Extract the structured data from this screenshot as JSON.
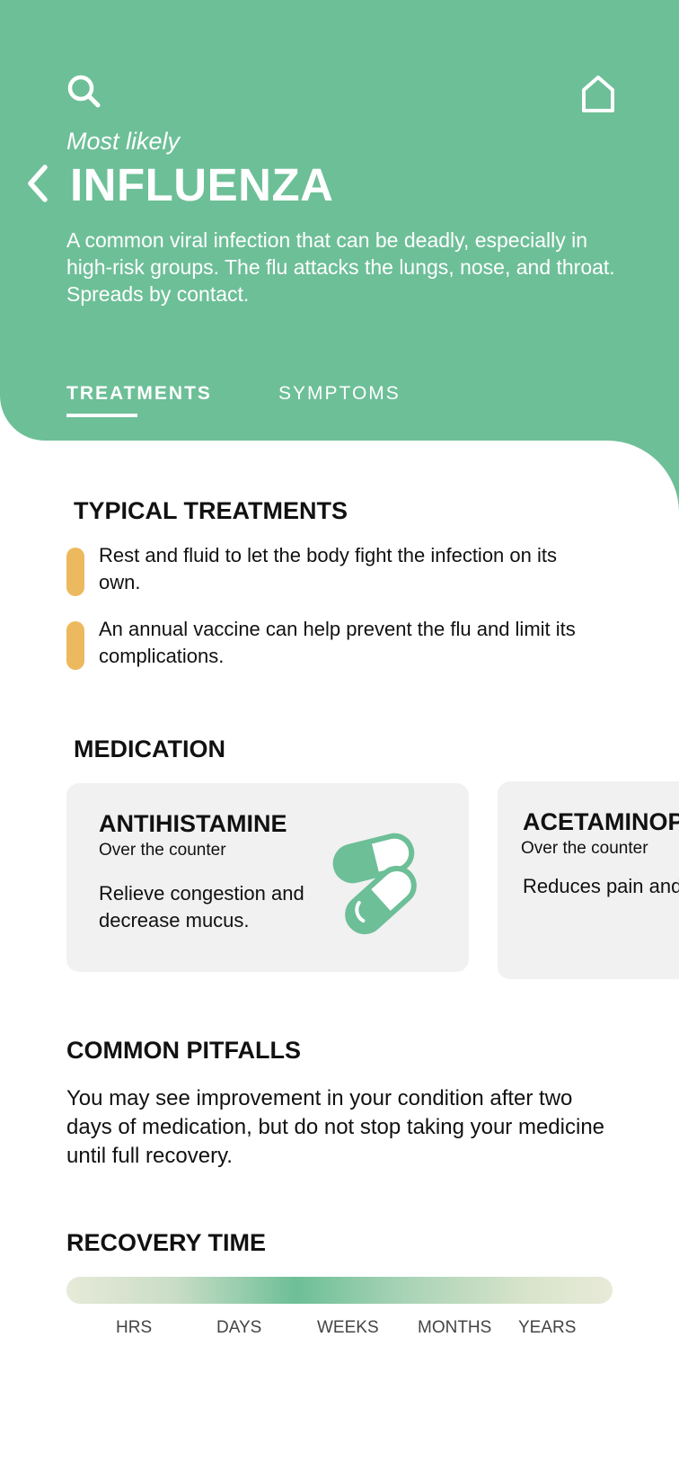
{
  "header": {
    "subtitle": "Most likely",
    "title": "INFLUENZA",
    "description": "A common viral infection that can be deadly, especially in high-risk groups. The flu attacks the lungs, nose, and throat. Spreads by contact.",
    "icons": {
      "search": "search-icon",
      "home": "home-icon",
      "back": "chevron-left-icon"
    }
  },
  "tabs": [
    {
      "label": "TREATMENTS",
      "active": true
    },
    {
      "label": "SYMPTOMS",
      "active": false
    }
  ],
  "typical_treatments": {
    "title": "TYPICAL TREATMENTS",
    "items": [
      "Rest and fluid to let the body fight the infection on its own.",
      "An annual vaccine can help prevent the flu and limit its complications."
    ]
  },
  "medication": {
    "title": "MEDICATION",
    "cards": [
      {
        "name": "ANTIHISTAMINE",
        "type": "Over the counter",
        "description": "Relieve congestion and decrease mucus.",
        "icon": "pills-icon"
      },
      {
        "name": "ACETAMINOPHEN",
        "type": "Over the counter",
        "description": "Reduces pain and fever."
      }
    ]
  },
  "common_pitfalls": {
    "title": "COMMON PITFALLS",
    "text": "You may see improvement in your condition after two days of medication, but do not stop taking your medicine until full recovery."
  },
  "recovery_time": {
    "title": "RECOVERY TIME",
    "labels": [
      "HRS",
      "DAYS",
      "WEEKS",
      "MONTHS",
      "YEARS"
    ],
    "highlighted": "WEEKS"
  },
  "colors": {
    "brand_green": "#6dbf97",
    "bullet_yellow": "#ecb95e",
    "card_bg": "#f1f1f1"
  }
}
